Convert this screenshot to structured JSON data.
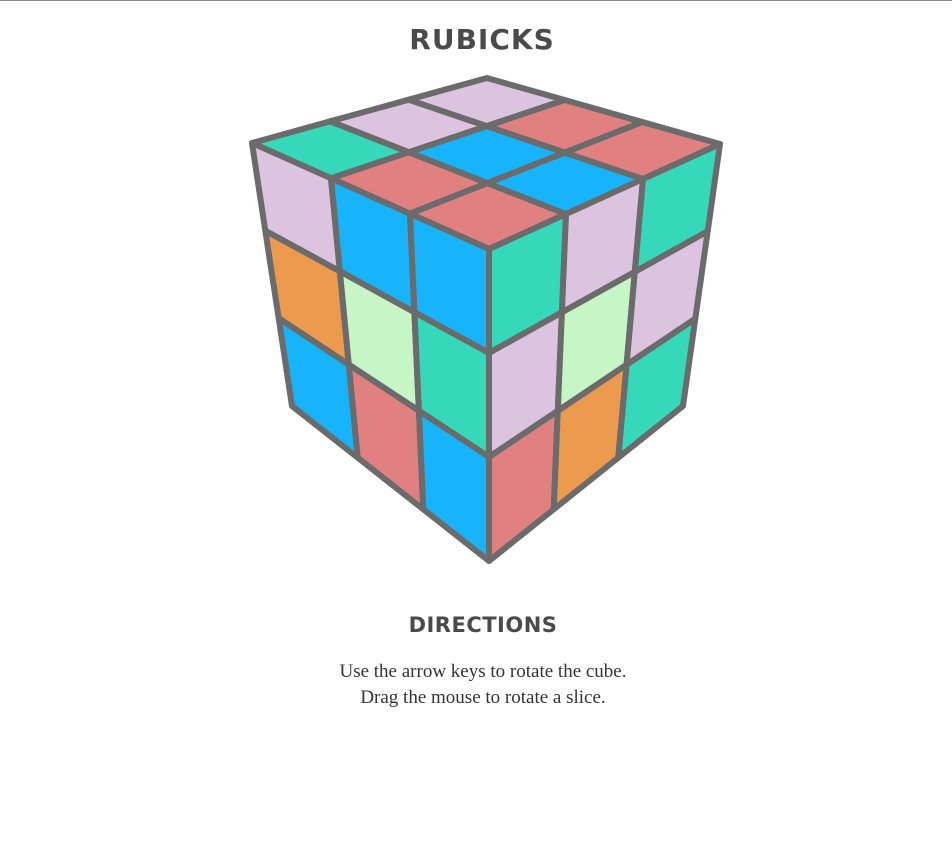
{
  "title": "RUBICKS",
  "directions": {
    "heading": "DIRECTIONS",
    "lines": [
      "Use the arrow keys to rotate the cube.",
      "Drag the mouse to rotate a slice."
    ]
  },
  "colors": {
    "outline": "#6b6b6b",
    "pink": "#dcc4e0",
    "teal": "#35d8b8",
    "blue": "#18b4fb",
    "red": "#e08080",
    "orange": "#ec9a4d",
    "mint": "#c6f5c6"
  },
  "cube": {
    "top_face": [
      [
        "teal",
        "pink",
        "pink"
      ],
      [
        "red",
        "blue",
        "red"
      ],
      [
        "red",
        "blue",
        "red"
      ]
    ],
    "left_face": [
      [
        "pink",
        "blue",
        "blue"
      ],
      [
        "orange",
        "mint",
        "teal"
      ],
      [
        "blue",
        "red",
        "blue"
      ]
    ],
    "right_face": [
      [
        "teal",
        "pink",
        "teal"
      ],
      [
        "pink",
        "mint",
        "pink"
      ],
      [
        "red",
        "orange",
        "teal"
      ]
    ]
  }
}
